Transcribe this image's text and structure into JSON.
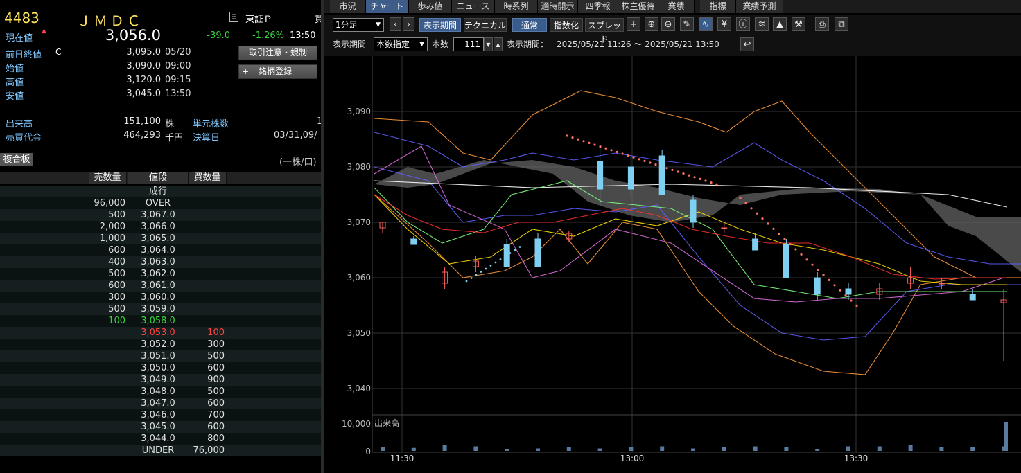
{
  "stock": {
    "code": "4483",
    "name": "ＪＭＤＣ",
    "market": "東証Ｐ",
    "market_icon": "document-icon",
    "buy_tab": "買"
  },
  "quote": {
    "current_label": "現在値",
    "current_price": "3,056.0",
    "change": "-39.0",
    "change_pct": "-1.26%",
    "time": "13:50",
    "prev_close_label": "前日終値",
    "prev_close_flag": "C",
    "prev_close": "3,095.0",
    "prev_close_date": "05/20",
    "open_label": "始値",
    "open": "3,090.0",
    "open_time": "09:00",
    "high_label": "高値",
    "high": "3,120.0",
    "high_time": "09:15",
    "low_label": "安値",
    "low": "3,045.0",
    "low_time": "13:50",
    "volume_label": "出来高",
    "volume": "151,100",
    "volume_unit": "株",
    "unit_label": "単元株数",
    "unit_value": "1",
    "turnover_label": "売買代金",
    "turnover": "464,293",
    "turnover_unit": "千円",
    "settle_label": "決算日",
    "settle_value": "03/31,09/",
    "trade_notice_button": "取引注意・規制",
    "register_button": "銘柄登録",
    "up_color": "#ff2020"
  },
  "board": {
    "tab_label": "複合板",
    "unit_note": "(一株/口)",
    "headers": {
      "sell": "売数量",
      "price": "値段",
      "buy": "買数量"
    },
    "rows": [
      {
        "sell": "",
        "price": "成行",
        "buy": ""
      },
      {
        "sell": "96,000",
        "price": "OVER",
        "buy": ""
      },
      {
        "sell": "500",
        "price": "3,067.0",
        "buy": ""
      },
      {
        "sell": "2,000",
        "price": "3,066.0",
        "buy": ""
      },
      {
        "sell": "1,000",
        "price": "3,065.0",
        "buy": ""
      },
      {
        "sell": "600",
        "price": "3,064.0",
        "buy": ""
      },
      {
        "sell": "400",
        "price": "3,063.0",
        "buy": ""
      },
      {
        "sell": "500",
        "price": "3,062.0",
        "buy": ""
      },
      {
        "sell": "600",
        "price": "3,061.0",
        "buy": ""
      },
      {
        "sell": "300",
        "price": "3,060.0",
        "buy": ""
      },
      {
        "sell": "500",
        "price": "3,059.0",
        "buy": ""
      },
      {
        "sell": "100",
        "price": "3,058.0",
        "buy": "",
        "color": "#3cd43c"
      },
      {
        "sell": "",
        "price": "3,053.0",
        "buy": "100",
        "color": "#ff4444"
      },
      {
        "sell": "",
        "price": "3,052.0",
        "buy": "300"
      },
      {
        "sell": "",
        "price": "3,051.0",
        "buy": "500"
      },
      {
        "sell": "",
        "price": "3,050.0",
        "buy": "600"
      },
      {
        "sell": "",
        "price": "3,049.0",
        "buy": "900"
      },
      {
        "sell": "",
        "price": "3,048.0",
        "buy": "500"
      },
      {
        "sell": "",
        "price": "3,047.0",
        "buy": "600"
      },
      {
        "sell": "",
        "price": "3,046.0",
        "buy": "700"
      },
      {
        "sell": "",
        "price": "3,045.0",
        "buy": "600"
      },
      {
        "sell": "",
        "price": "3,044.0",
        "buy": "800"
      },
      {
        "sell": "",
        "price": "UNDER",
        "buy": "76,000"
      }
    ]
  },
  "tabs": [
    {
      "label": "市況"
    },
    {
      "label": "チャート",
      "active": true
    },
    {
      "label": "歩み値"
    },
    {
      "label": "ニュース"
    },
    {
      "label": "時系列"
    },
    {
      "label": "適時開示"
    },
    {
      "label": "四季報"
    },
    {
      "label": "株主優待"
    },
    {
      "label": "業績"
    },
    {
      "label": "指標"
    },
    {
      "label": "業績予測"
    }
  ],
  "toolbar": {
    "interval": "1分足",
    "period_button": "表示期間",
    "technical_button": "テクニカル",
    "normal_button": "通常",
    "index_button": "指数化",
    "spread_button": "スプレッド",
    "icons": [
      "crosshair-icon",
      "zoom-in-icon",
      "zoom-out-icon",
      "pencil-icon",
      "chart-type-icon",
      "yen-icon",
      "info-icon",
      "moving-average-icon",
      "area-chart-icon",
      "wrench-icon",
      "print-icon",
      "export-icon"
    ],
    "period_label": "表示期間",
    "period_mode": "本数指定",
    "count_label": "本数",
    "count_value": "111",
    "range_label": "表示期間：",
    "range_value": "2025/05/21 11:26 ～ 2025/05/21 13:50",
    "undo_icon": "return-icon"
  },
  "chart_data": {
    "type": "candlestick",
    "interval": "1分足",
    "y_ticks": [
      "3,090",
      "3,080",
      "3,070",
      "3,060",
      "3,050",
      "3,040"
    ],
    "ylim": [
      3040,
      3090
    ],
    "x_ticks": [
      "11:30",
      "13:00",
      "13:30"
    ],
    "volume_label": "出来高",
    "volume_ticks": [
      "10,000",
      "0"
    ],
    "candles": [
      {
        "o": 3069.0,
        "h": 3070.0,
        "l": 3068.0,
        "c": 3070.0
      },
      {
        "o": 3067.0,
        "h": 3067.5,
        "l": 3066.0,
        "c": 3066.0
      },
      {
        "o": 3059.0,
        "h": 3062.0,
        "l": 3058.0,
        "c": 3061.0
      },
      {
        "o": 3062.0,
        "h": 3064.0,
        "l": 3061.0,
        "c": 3063.0
      },
      {
        "o": 3066.0,
        "h": 3067.0,
        "l": 3062.0,
        "c": 3062.0
      },
      {
        "o": 3067.0,
        "h": 3068.0,
        "l": 3062.0,
        "c": 3062.0
      },
      {
        "o": 3067.0,
        "h": 3068.5,
        "l": 3066.5,
        "c": 3068.0
      },
      {
        "o": 3081.0,
        "h": 3084.0,
        "l": 3073.0,
        "c": 3076.0
      },
      {
        "o": 3080.0,
        "h": 3082.0,
        "l": 3075.0,
        "c": 3076.0
      },
      {
        "o": 3082.0,
        "h": 3083.0,
        "l": 3075.0,
        "c": 3075.0
      },
      {
        "o": 3074.0,
        "h": 3075.0,
        "l": 3069.0,
        "c": 3070.0
      },
      {
        "o": 3069.0,
        "h": 3070.0,
        "l": 3068.0,
        "c": 3069.0
      },
      {
        "o": 3067.0,
        "h": 3068.0,
        "l": 3065.0,
        "c": 3065.0
      },
      {
        "o": 3066.0,
        "h": 3067.0,
        "l": 3060.0,
        "c": 3060.0
      },
      {
        "o": 3060.0,
        "h": 3061.0,
        "l": 3056.0,
        "c": 3057.0
      },
      {
        "o": 3058.0,
        "h": 3059.0,
        "l": 3056.0,
        "c": 3057.0
      },
      {
        "o": 3057.0,
        "h": 3059.0,
        "l": 3056.0,
        "c": 3058.0
      },
      {
        "o": 3059.0,
        "h": 3062.0,
        "l": 3058.0,
        "c": 3060.0
      },
      {
        "o": 3059.0,
        "h": 3060.0,
        "l": 3058.0,
        "c": 3059.0
      },
      {
        "o": 3057.0,
        "h": 3058.0,
        "l": 3056.0,
        "c": 3056.0
      },
      {
        "o": 3055.5,
        "h": 3058.0,
        "l": 3045.0,
        "c": 3056.0
      }
    ],
    "colors": {
      "up": "#ff6060",
      "down": "#7fd0f0",
      "grid": "#2a2a2a"
    }
  }
}
